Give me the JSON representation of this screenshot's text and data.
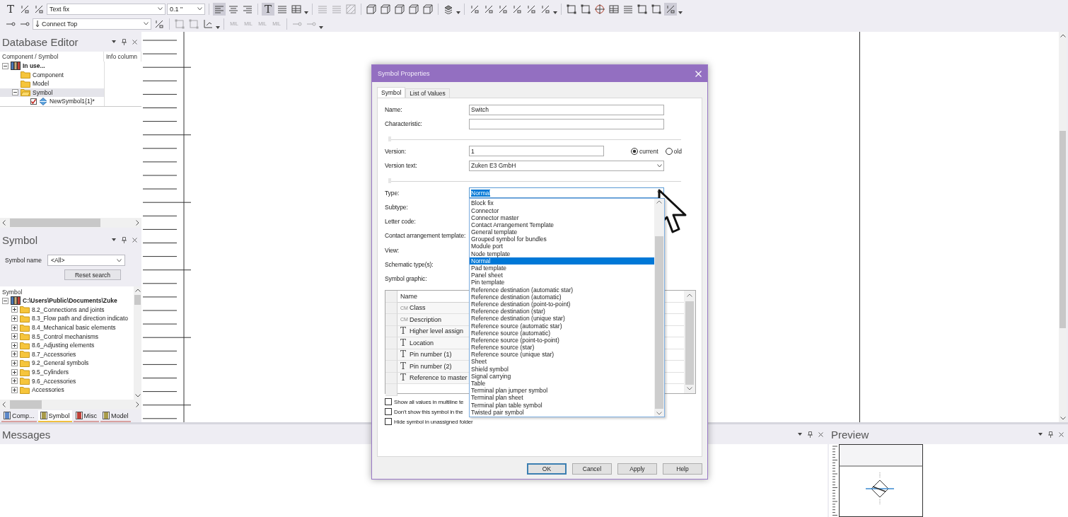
{
  "toolbar": {
    "rows": [
      {
        "items": [
          {
            "kind": "glyph",
            "label": "T"
          },
          {
            "kind": "fraction"
          },
          {
            "kind": "fraction"
          },
          {
            "kind": "dropdown",
            "value": "Text fix"
          },
          {
            "kind": "dropdown",
            "value": "0.1 \""
          },
          {
            "kind": "separator"
          },
          {
            "kind": "align-left",
            "selected": true
          },
          {
            "kind": "align-center",
            "selected": false
          },
          {
            "kind": "align-right",
            "selected": false
          },
          {
            "kind": "separator"
          },
          {
            "kind": "glyph",
            "label": "T",
            "selected": true
          },
          {
            "kind": "lines"
          },
          {
            "kind": "table"
          },
          {
            "kind": "caret"
          },
          {
            "kind": "separator"
          },
          {
            "kind": "lines",
            "disabled": true
          },
          {
            "kind": "lines",
            "disabled": true
          },
          {
            "kind": "hatch",
            "disabled": true
          },
          {
            "kind": "separator"
          },
          {
            "kind": "cube"
          },
          {
            "kind": "cube"
          },
          {
            "kind": "cube"
          },
          {
            "kind": "cube"
          },
          {
            "kind": "cube"
          },
          {
            "kind": "separator"
          },
          {
            "kind": "layers"
          },
          {
            "kind": "caret"
          },
          {
            "kind": "separator"
          },
          {
            "kind": "fraction"
          },
          {
            "kind": "fraction"
          },
          {
            "kind": "fraction"
          },
          {
            "kind": "fraction"
          },
          {
            "kind": "fraction"
          },
          {
            "kind": "fraction"
          },
          {
            "kind": "caret"
          },
          {
            "kind": "separator"
          },
          {
            "kind": "frame"
          },
          {
            "kind": "frame"
          },
          {
            "kind": "crosshair"
          },
          {
            "kind": "table"
          },
          {
            "kind": "lines"
          },
          {
            "kind": "frame"
          },
          {
            "kind": "frame"
          },
          {
            "kind": "fraction",
            "selected": true
          },
          {
            "kind": "caret"
          }
        ]
      },
      {
        "items": [
          {
            "kind": "connector"
          },
          {
            "kind": "connector"
          },
          {
            "kind": "arrow-dropdown",
            "value": "Connect Top"
          },
          {
            "kind": "fraction"
          },
          {
            "kind": "separator"
          },
          {
            "kind": "frame",
            "disabled": true
          },
          {
            "kind": "frame",
            "disabled": true
          },
          {
            "kind": "axis"
          },
          {
            "kind": "caret"
          },
          {
            "kind": "separator"
          },
          {
            "kind": "glyph",
            "label": "MIL",
            "disabled": true
          },
          {
            "kind": "glyph",
            "label": "MIL",
            "disabled": true
          },
          {
            "kind": "glyph",
            "label": "MIL",
            "disabled": true
          },
          {
            "kind": "glyph",
            "label": "MIL",
            "disabled": true
          },
          {
            "kind": "separator"
          },
          {
            "kind": "connector",
            "disabled": true
          },
          {
            "kind": "connector",
            "disabled": true
          },
          {
            "kind": "caret"
          }
        ]
      }
    ]
  },
  "database_editor": {
    "title": "Database Editor",
    "columns": [
      "Component / Symbol",
      "Info column"
    ],
    "tree": [
      {
        "label": "In use...",
        "kind": "library",
        "expanded": true,
        "children": [
          {
            "label": "Component",
            "kind": "folder"
          },
          {
            "label": "Model",
            "kind": "folder"
          },
          {
            "label": "Symbol",
            "kind": "open-folder",
            "expanded": true,
            "selected": true,
            "children": [
              {
                "label": "NewSymbol1{1}*",
                "kind": "symbol",
                "checked": true
              }
            ]
          }
        ]
      }
    ]
  },
  "symbol_panel": {
    "title": "Symbol",
    "filter_label": "Symbol name",
    "filter_value": "<All>",
    "reset_button": "Reset search",
    "tree_header": "Symbol",
    "tree": [
      {
        "label": "C:\\Users\\Public\\Documents\\Zuke",
        "kind": "library",
        "expanded": true,
        "children": [
          {
            "label": "8.2_Connections and joints",
            "kind": "folder",
            "expanded": false
          },
          {
            "label": "8.3_Flow path and direction indicato",
            "kind": "folder",
            "expanded": false
          },
          {
            "label": "8.4_Mechanical basic elements",
            "kind": "folder",
            "expanded": false
          },
          {
            "label": "8.5_Control mechanisms",
            "kind": "folder",
            "expanded": false
          },
          {
            "label": "8.6_Adjusting elements",
            "kind": "folder",
            "expanded": false
          },
          {
            "label": "8.7_Accessories",
            "kind": "folder",
            "expanded": false
          },
          {
            "label": "9.2_General symbols",
            "kind": "folder",
            "expanded": false
          },
          {
            "label": "9.5_Cylinders",
            "kind": "folder",
            "expanded": false
          },
          {
            "label": "9.6_Accessories",
            "kind": "folder",
            "expanded": false
          },
          {
            "label": "Accessories",
            "kind": "folder",
            "expanded": false
          }
        ]
      }
    ],
    "tabs": [
      {
        "label": "Comp...",
        "selected": false
      },
      {
        "label": "Symbol",
        "selected": true
      },
      {
        "label": "Misc",
        "selected": false
      },
      {
        "label": "Model",
        "selected": false
      }
    ]
  },
  "messages": {
    "title": "Messages"
  },
  "preview": {
    "title": "Preview"
  },
  "dialog": {
    "title": "Symbol Properties",
    "tabs": [
      {
        "label": "Symbol",
        "selected": true
      },
      {
        "label": "List of Values",
        "selected": false
      }
    ],
    "form": [
      {
        "kind": "text",
        "label": "Name:",
        "value": "Switch"
      },
      {
        "kind": "text",
        "label": "Characteristic:"
      },
      {
        "kind": "divider"
      },
      {
        "kind": "version",
        "label": "Version:",
        "value": "1",
        "options": [
          {
            "label": "current",
            "selected": true
          },
          {
            "label": "old",
            "selected": false
          }
        ]
      },
      {
        "kind": "select",
        "label": "Version text:",
        "value": "Zuken E3 GmbH"
      },
      {
        "kind": "divider"
      },
      {
        "kind": "select",
        "label": "Type:",
        "value": "Normal",
        "expanded": true,
        "options": [
          {
            "label": "Block fix",
            "selected": false
          },
          {
            "label": "Connector",
            "selected": false
          },
          {
            "label": "Connector master",
            "selected": false
          },
          {
            "label": "Contact Arrangement Template",
            "selected": false
          },
          {
            "label": "General template",
            "selected": false
          },
          {
            "label": "Grouped symbol for bundles",
            "selected": false
          },
          {
            "label": "Module port",
            "selected": false
          },
          {
            "label": "Node template",
            "selected": false
          },
          {
            "label": "Normal",
            "selected": true
          },
          {
            "label": "Pad template",
            "selected": false
          },
          {
            "label": "Panel sheet",
            "selected": false
          },
          {
            "label": "Pin template",
            "selected": false
          },
          {
            "label": "Reference destination (automatic star)",
            "selected": false
          },
          {
            "label": "Reference destination (automatic)",
            "selected": false
          },
          {
            "label": "Reference destination (point-to-point)",
            "selected": false
          },
          {
            "label": "Reference destination (star)",
            "selected": false
          },
          {
            "label": "Reference destination (unique star)",
            "selected": false
          },
          {
            "label": "Reference source (automatic star)",
            "selected": false
          },
          {
            "label": "Reference source (automatic)",
            "selected": false
          },
          {
            "label": "Reference source (point-to-point)",
            "selected": false
          },
          {
            "label": "Reference source (star)",
            "selected": false
          },
          {
            "label": "Reference source (unique star)",
            "selected": false
          },
          {
            "label": "Sheet",
            "selected": false
          },
          {
            "label": "Shield symbol",
            "selected": false
          },
          {
            "label": "Signal carrying",
            "selected": false
          },
          {
            "label": "Table",
            "selected": false
          },
          {
            "label": "Terminal plan jumper symbol",
            "selected": false
          },
          {
            "label": "Terminal plan sheet",
            "selected": false
          },
          {
            "label": "Terminal plan table symbol",
            "selected": false
          },
          {
            "label": "Twisted pair symbol",
            "selected": false
          }
        ]
      },
      {
        "kind": "label",
        "label": "Subtype:"
      },
      {
        "kind": "label",
        "label": "Letter code:"
      },
      {
        "kind": "label",
        "label": "Contact arrangement template:"
      },
      {
        "kind": "label",
        "label": "View:"
      },
      {
        "kind": "label",
        "label": "Schematic type(s):"
      },
      {
        "kind": "label",
        "label": "Symbol graphic:"
      }
    ],
    "table": {
      "columns": [
        "Name"
      ],
      "rows": [
        {
          "kind": "cm",
          "prefix": "CM",
          "name": "Class"
        },
        {
          "kind": "cm",
          "prefix": "CM",
          "name": "Description"
        },
        {
          "kind": "text",
          "prefix": "T",
          "name": "Higher level assign"
        },
        {
          "kind": "text",
          "prefix": "T",
          "name": "Location"
        },
        {
          "kind": "text",
          "prefix": "T",
          "name": "Pin number (1)"
        },
        {
          "kind": "text",
          "prefix": "T",
          "name": "Pin number (2)"
        },
        {
          "kind": "text",
          "prefix": "T",
          "name": "Reference to master"
        }
      ]
    },
    "checkboxes": [
      {
        "label": "Show all values in multiline te",
        "checked": false
      },
      {
        "label": "Don't show this symbol in the",
        "checked": false
      },
      {
        "label": "Hide symbol in unassigned folder",
        "checked": false
      }
    ],
    "buttons": [
      {
        "label": "OK",
        "default": true
      },
      {
        "label": "Cancel",
        "default": false
      },
      {
        "label": "Apply",
        "default": false
      },
      {
        "label": "Help",
        "default": false
      }
    ]
  }
}
